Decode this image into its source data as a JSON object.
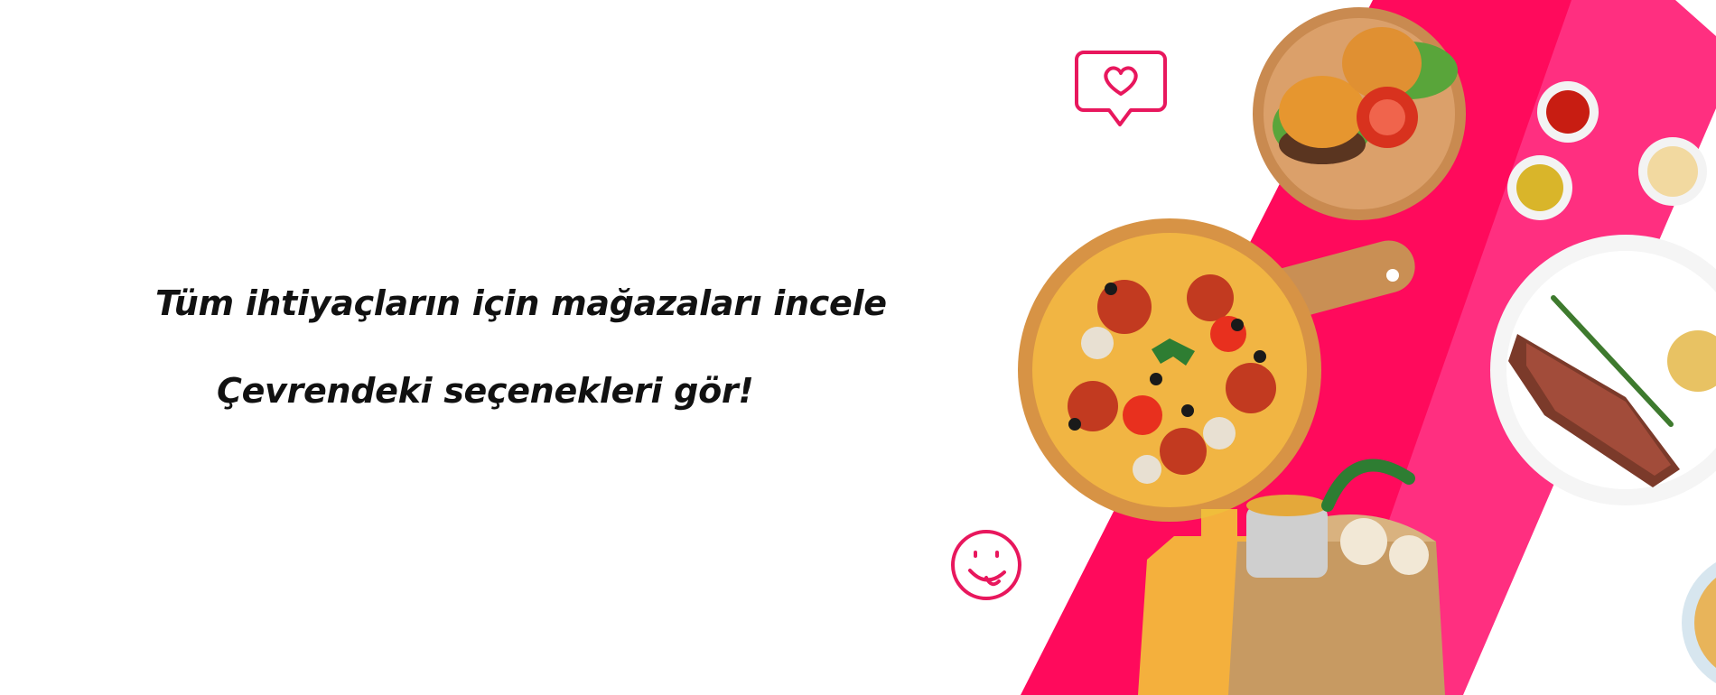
{
  "hero": {
    "headline": "Tüm ihtiyaçların için mağazaları incele",
    "subheadline": "Çevrendeki seçenekleri gör!"
  },
  "colors": {
    "band_primary": "#ff0a5c",
    "band_secondary": "#ff2f80",
    "icon_outline": "#e8175d",
    "text": "#111111"
  },
  "icons": {
    "like_bubble": "heart-speech-bubble-icon",
    "smiley": "yummy-smiley-icon"
  }
}
